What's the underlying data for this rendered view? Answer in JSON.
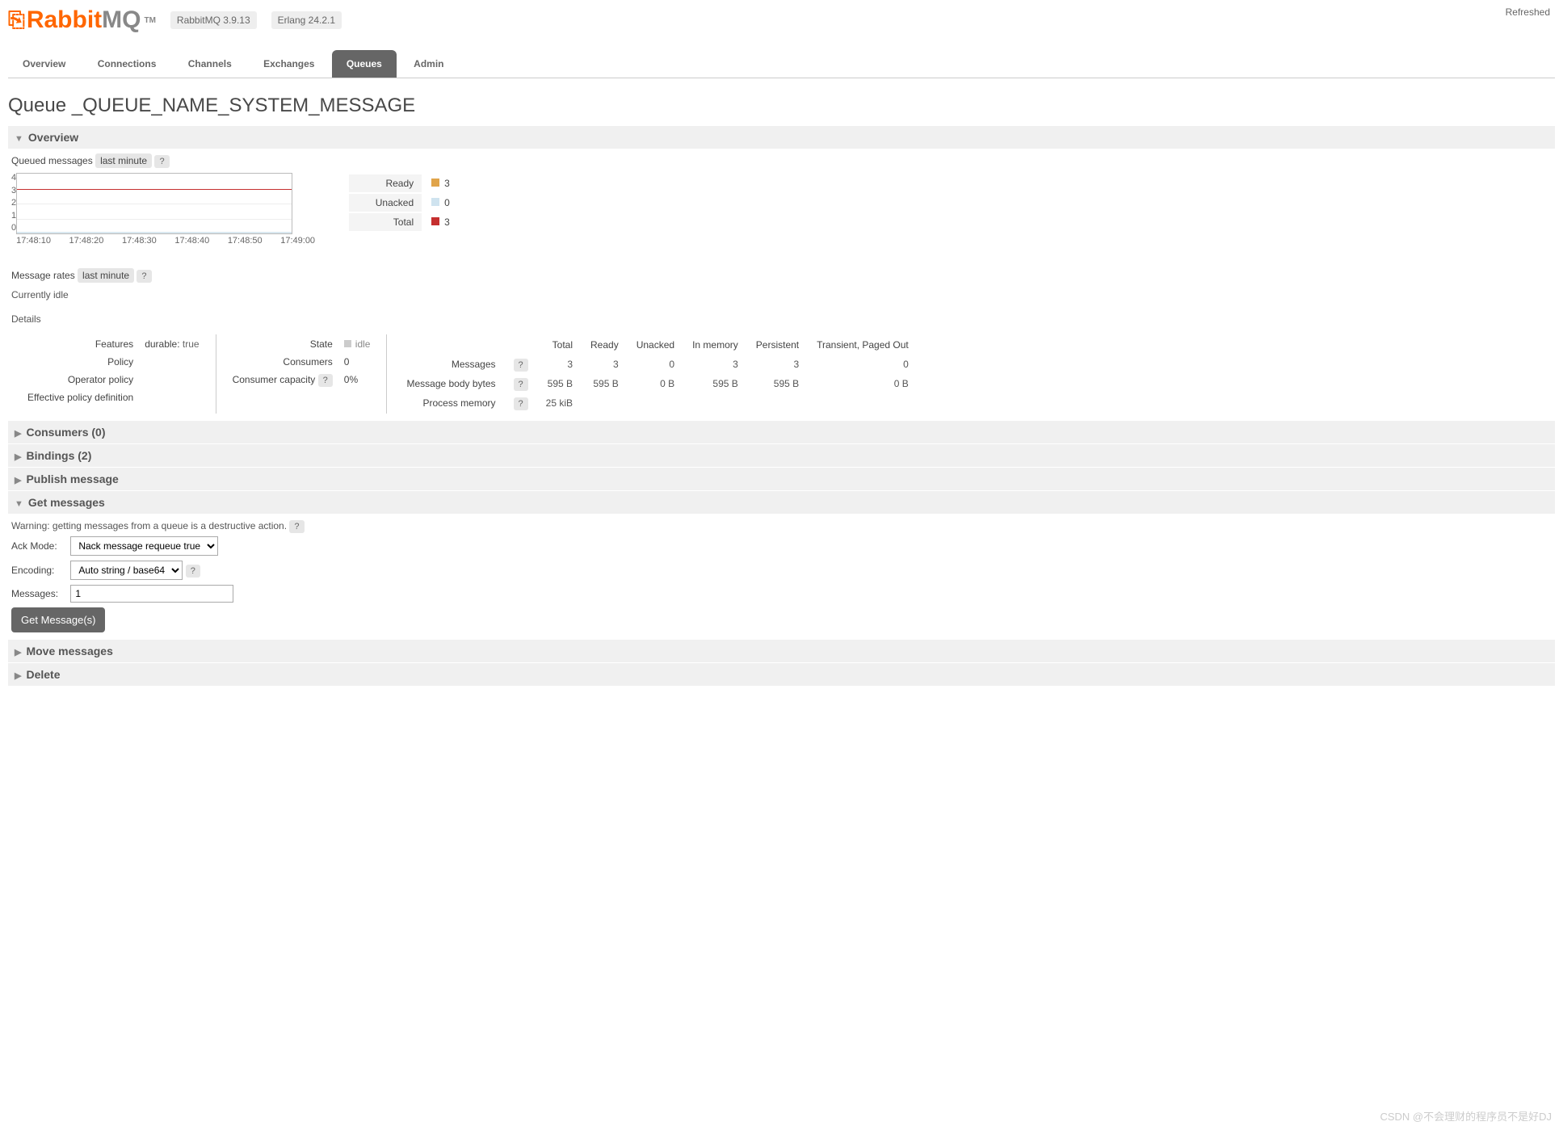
{
  "header": {
    "refreshed": "Refreshed",
    "brand_r": "Rabbit",
    "brand_mq": "MQ",
    "tm": "TM",
    "version": "RabbitMQ 3.9.13",
    "erlang": "Erlang 24.2.1"
  },
  "tabs": [
    "Overview",
    "Connections",
    "Channels",
    "Exchanges",
    "Queues",
    "Admin"
  ],
  "active_tab": "Queues",
  "page_title": "Queue _QUEUE_NAME_SYSTEM_MESSAGE",
  "overview": {
    "title": "Overview",
    "queued_label": "Queued messages",
    "time_range": "last minute",
    "rates_label": "Message rates",
    "idle": "Currently idle",
    "details": "Details",
    "legend": [
      {
        "label": "Ready",
        "color": "#e0a44a",
        "value": "3"
      },
      {
        "label": "Unacked",
        "color": "#cfe3ef",
        "value": "0"
      },
      {
        "label": "Total",
        "color": "#c52f2f",
        "value": "3"
      }
    ]
  },
  "chart_data": {
    "type": "line",
    "title": "Queued messages",
    "xlabel": "",
    "ylabel": "",
    "x": [
      "17:48:10",
      "17:48:20",
      "17:48:30",
      "17:48:40",
      "17:48:50",
      "17:49:00"
    ],
    "ylim": [
      0,
      4
    ],
    "yticks": [
      0.0,
      1.0,
      2.0,
      3.0,
      4.0
    ],
    "series": [
      {
        "name": "Ready",
        "color": "#e0a44a",
        "values": [
          3,
          3,
          3,
          3,
          3,
          3
        ]
      },
      {
        "name": "Unacked",
        "color": "#cfe3ef",
        "values": [
          0,
          0,
          0,
          0,
          0,
          0
        ]
      },
      {
        "name": "Total",
        "color": "#c52f2f",
        "values": [
          3,
          3,
          3,
          3,
          3,
          3
        ]
      }
    ]
  },
  "details_left": {
    "features_label": "Features",
    "durable_label": "durable:",
    "durable": "true",
    "policy_label": "Policy",
    "op_policy_label": "Operator policy",
    "eff_policy_label": "Effective policy definition"
  },
  "details_mid": {
    "state_label": "State",
    "state": "idle",
    "consumers_label": "Consumers",
    "consumers": "0",
    "capacity_label": "Consumer capacity",
    "capacity": "0%"
  },
  "stats": {
    "cols": [
      "Total",
      "Ready",
      "Unacked",
      "In memory",
      "Persistent",
      "Transient, Paged Out"
    ],
    "rows": [
      {
        "label": "Messages",
        "vals": [
          "3",
          "3",
          "0",
          "3",
          "3",
          "0"
        ]
      },
      {
        "label": "Message body bytes",
        "vals": [
          "595 B",
          "595 B",
          "0 B",
          "595 B",
          "595 B",
          "0 B"
        ]
      },
      {
        "label": "Process memory",
        "vals": [
          "25 kiB",
          "",
          "",
          "",
          "",
          ""
        ]
      }
    ]
  },
  "sections": {
    "consumers": "Consumers (0)",
    "bindings": "Bindings (2)",
    "publish": "Publish message",
    "get": "Get messages",
    "move": "Move messages",
    "delete": "Delete"
  },
  "get_messages": {
    "warning": "Warning: getting messages from a queue is a destructive action.",
    "ack_label": "Ack Mode:",
    "ack_value": "Nack message requeue true",
    "enc_label": "Encoding:",
    "enc_value": "Auto string / base64",
    "msgs_label": "Messages:",
    "msgs_value": "1",
    "button": "Get Message(s)"
  },
  "watermark": "CSDN @不会理财的程序员不是好DJ"
}
